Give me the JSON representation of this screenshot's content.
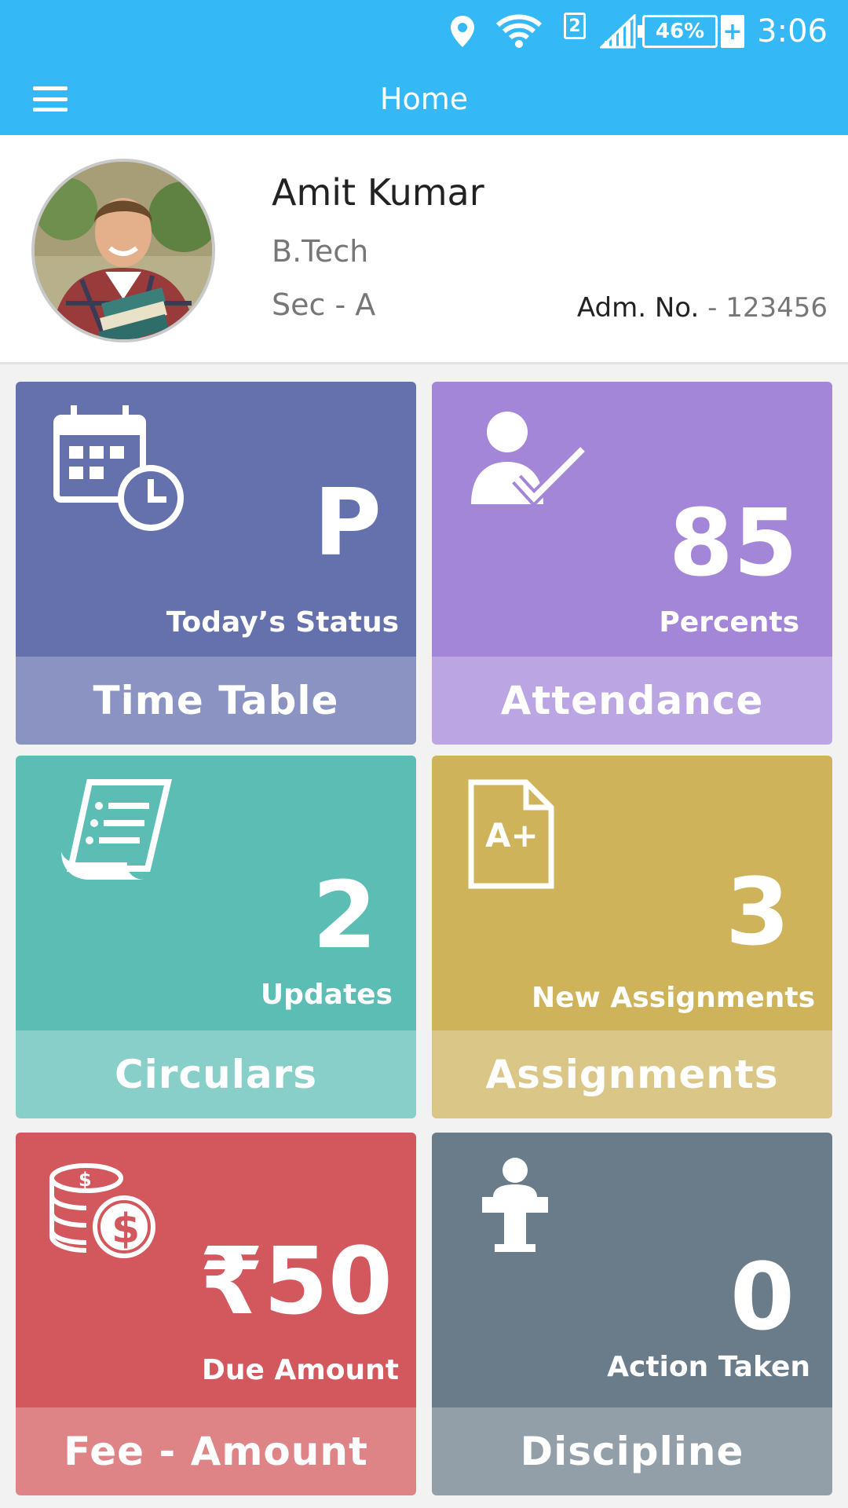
{
  "status_bar": {
    "time": "3:06",
    "battery": "46%",
    "sim_badge": "2",
    "charging": "+"
  },
  "app_bar": {
    "title": "Home"
  },
  "profile": {
    "name": "Amit Kumar",
    "course": "B.Tech",
    "section": "Sec - A",
    "adm_label": "Adm. No.",
    "adm_value": " - 123456"
  },
  "tiles": [
    {
      "value": "P",
      "caption": "Today’s Status",
      "title": "Time Table",
      "icon": "calendar-clock-icon",
      "color": "#6471ad"
    },
    {
      "value": "85",
      "caption": "Percents",
      "title": "Attendance",
      "icon": "user-check-icon",
      "color": "#a386d8"
    },
    {
      "value": "2",
      "caption": "Updates",
      "title": "Circulars",
      "icon": "scroll-list-icon",
      "color": "#5bbdb4"
    },
    {
      "value": "3",
      "caption": "New Assignments",
      "title": "Assignments",
      "icon": "graded-document-icon",
      "color": "#cfb35a"
    },
    {
      "value": "₹50",
      "caption": "Due Amount",
      "title": "Fee - Amount",
      "icon": "coins-dollar-icon",
      "color": "#d2585e"
    },
    {
      "value": "0",
      "caption": "Action Taken",
      "title": "Discipline",
      "icon": "podium-speaker-icon",
      "color": "#6a7b89"
    }
  ]
}
